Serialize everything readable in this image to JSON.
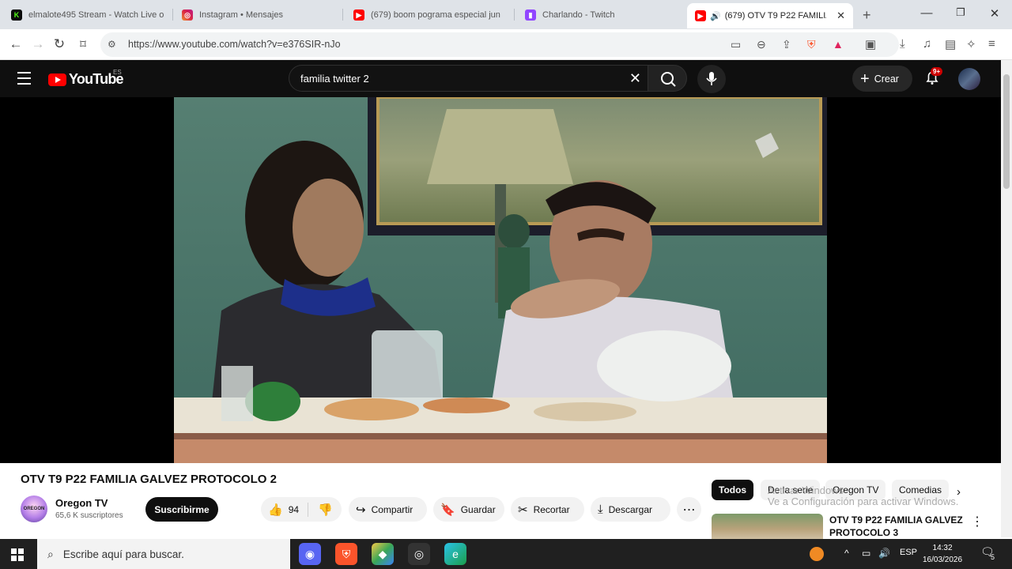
{
  "browser": {
    "tabs": [
      {
        "title": "elmalote495 Stream - Watch Live o",
        "icon": "kick-icon",
        "color": "#53fc18"
      },
      {
        "title": "Instagram • Mensajes",
        "icon": "instagram-icon",
        "color": "#e1306c"
      },
      {
        "title": "(679) boom pograma especial jun",
        "icon": "youtube-icon",
        "color": "#ff0000"
      },
      {
        "title": "Charlando - Twitch",
        "icon": "twitch-icon",
        "color": "#9146ff"
      },
      {
        "title": "(679) OTV T9 P22 FAMILIA",
        "icon": "youtube-icon",
        "color": "#ff0000",
        "active": true
      }
    ],
    "url": "https://www.youtube.com/watch?v=e376SIR-nJo"
  },
  "youtube": {
    "logo_text": "YouTube",
    "country_code": "ES",
    "search_query": "familia twitter 2",
    "create_label": "Crear",
    "notifications_badge": "9+"
  },
  "video": {
    "title": "OTV T9 P22 FAMILIA GALVEZ PROTOCOLO 2",
    "channel_name": "Oregon TV",
    "channel_avatar_text": "OREGON",
    "subscribers": "65,6 K suscriptores",
    "subscribe_label": "Suscribirme",
    "likes": "94",
    "share_label": "Compartir",
    "save_label": "Guardar",
    "clip_label": "Recortar",
    "download_label": "Descargar"
  },
  "sidebar": {
    "chips": [
      "Todos",
      "De la serie",
      "Oregon TV",
      "Comedias"
    ],
    "watermark": "Activar Windows\nVe a Configuración para activar Windows.",
    "recommended": {
      "title": "OTV T9 P22 FAMILIA GALVEZ PROTOCOLO 3"
    }
  },
  "taskbar": {
    "search_placeholder": "Escribe aquí para buscar.",
    "language": "ESP",
    "time": "14:32",
    "date": "16/03/2026",
    "notifications_count": "5"
  }
}
